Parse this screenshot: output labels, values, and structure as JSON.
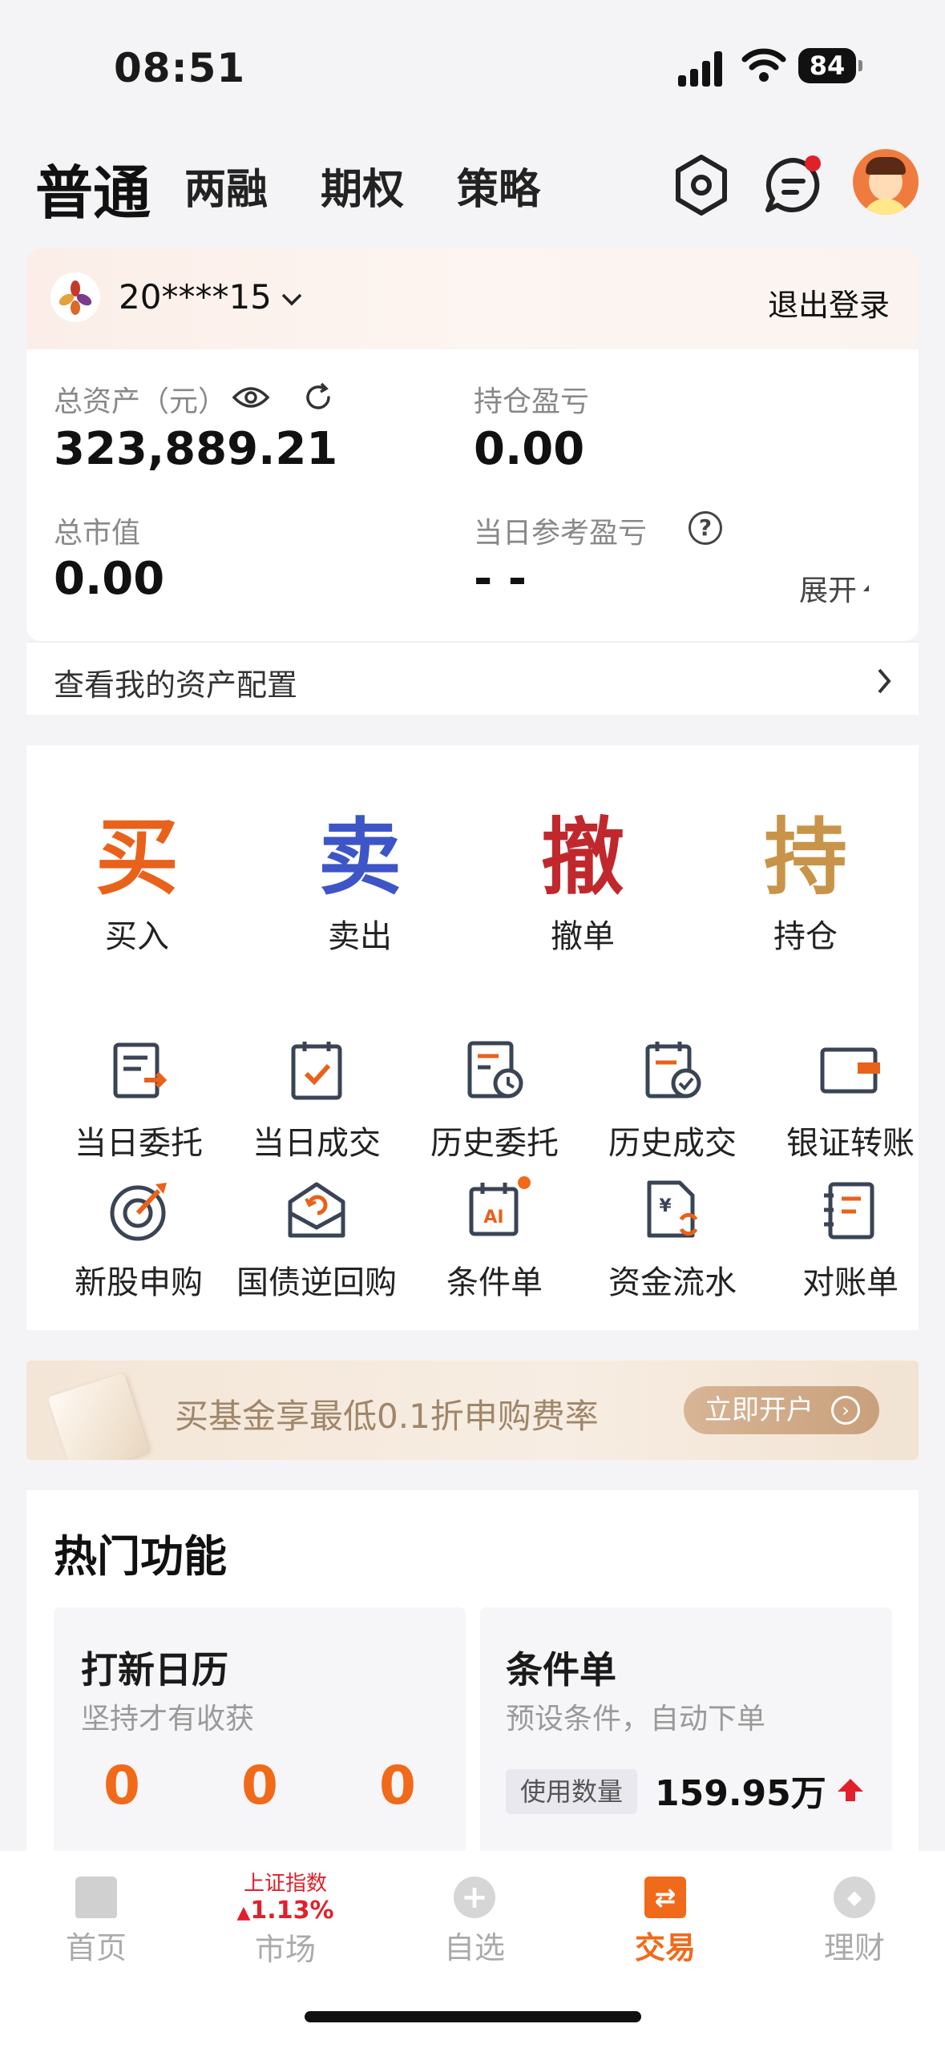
{
  "status_bar": {
    "time": "08:51",
    "battery": "84"
  },
  "header": {
    "tabs": [
      "普通",
      "两融",
      "期权",
      "策略"
    ],
    "active_tab": "普通"
  },
  "account": {
    "account_id": "20****15",
    "logout": "退出登录",
    "total_assets_label": "总资产（元）",
    "total_assets": "323,889.21",
    "holding_pnl_label": "持仓盈亏",
    "holding_pnl": "0.00",
    "market_value_label": "总市值",
    "market_value": "0.00",
    "daily_pnl_label": "当日参考盈亏",
    "daily_pnl": "- -",
    "expand": "展开",
    "asset_allocation_link": "查看我的资产配置"
  },
  "primary_actions": [
    {
      "glyph": "买",
      "label": "买入",
      "color": "#e8621b"
    },
    {
      "glyph": "卖",
      "label": "卖出",
      "color": "#3d55c7"
    },
    {
      "glyph": "撤",
      "label": "撤单",
      "color": "#c0282d"
    },
    {
      "glyph": "持",
      "label": "持仓",
      "color": "#c8944a"
    }
  ],
  "secondary_actions": [
    {
      "label": "当日委托",
      "icon": "order-doc-arrow-icon"
    },
    {
      "label": "当日成交",
      "icon": "deal-doc-check-icon"
    },
    {
      "label": "历史委托",
      "icon": "history-order-clock-icon"
    },
    {
      "label": "历史成交",
      "icon": "history-deal-check-icon"
    },
    {
      "label": "银证转账",
      "icon": "wallet-transfer-icon"
    },
    {
      "label": "新股申购",
      "icon": "target-dart-icon"
    },
    {
      "label": "国债逆回购",
      "icon": "envelope-return-icon"
    },
    {
      "label": "条件单",
      "icon": "ai-calendar-icon"
    },
    {
      "label": "资金流水",
      "icon": "yuan-flow-icon"
    },
    {
      "label": "对账单",
      "icon": "statement-list-icon"
    }
  ],
  "banner": {
    "text": "买基金享最低0.1折申购费率",
    "button": "立即开户"
  },
  "hot": {
    "title": "热门功能",
    "ipo": {
      "title": "打新日历",
      "subtitle": "坚持才有收获",
      "counts": [
        "0",
        "0",
        "0"
      ]
    },
    "conditional": {
      "title": "条件单",
      "subtitle": "预设条件，自动下单",
      "usage_label": "使用数量",
      "usage_value": "159.95万"
    }
  },
  "bottom_nav": {
    "items": [
      "首页",
      "市场",
      "自选",
      "交易",
      "理财"
    ],
    "active": "交易",
    "market_index_name": "上证指数",
    "market_index_change": "1.13%"
  },
  "colors": {
    "accent": "#e8621b",
    "up": "#e0202a"
  }
}
